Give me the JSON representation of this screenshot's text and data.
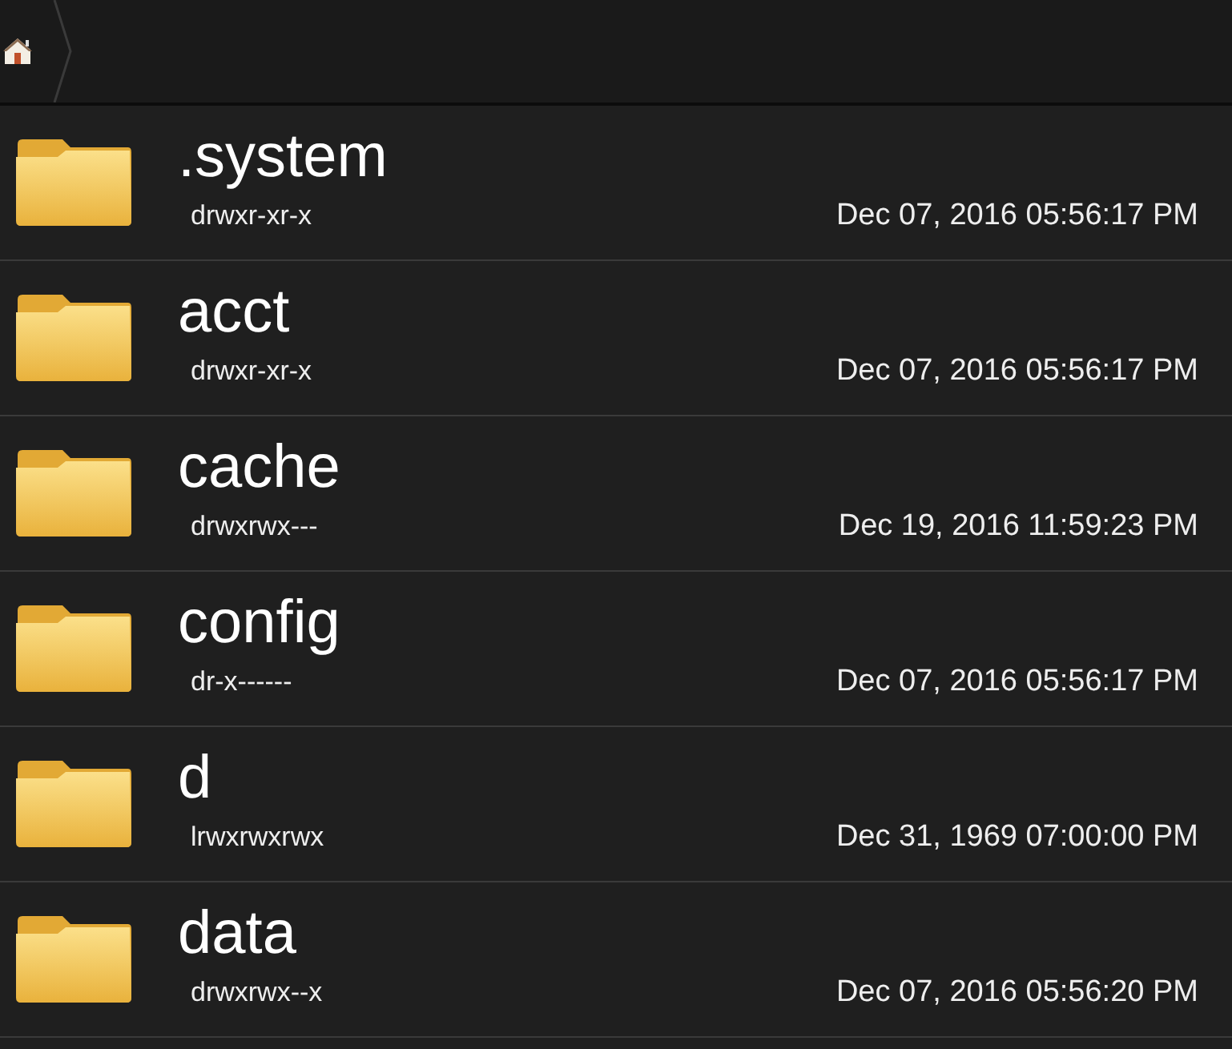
{
  "breadcrumb": {
    "kind": "home"
  },
  "files": [
    {
      "name": ".system",
      "permissions": "drwxr-xr-x",
      "modified": "Dec 07, 2016 05:56:17 PM"
    },
    {
      "name": "acct",
      "permissions": "drwxr-xr-x",
      "modified": "Dec 07, 2016 05:56:17 PM"
    },
    {
      "name": "cache",
      "permissions": "drwxrwx---",
      "modified": "Dec 19, 2016 11:59:23 PM"
    },
    {
      "name": "config",
      "permissions": "dr-x------",
      "modified": "Dec 07, 2016 05:56:17 PM"
    },
    {
      "name": "d",
      "permissions": "lrwxrwxrwx",
      "modified": "Dec 31, 1969 07:00:00 PM"
    },
    {
      "name": "data",
      "permissions": "drwxrwx--x",
      "modified": "Dec 07, 2016 05:56:20 PM"
    }
  ]
}
